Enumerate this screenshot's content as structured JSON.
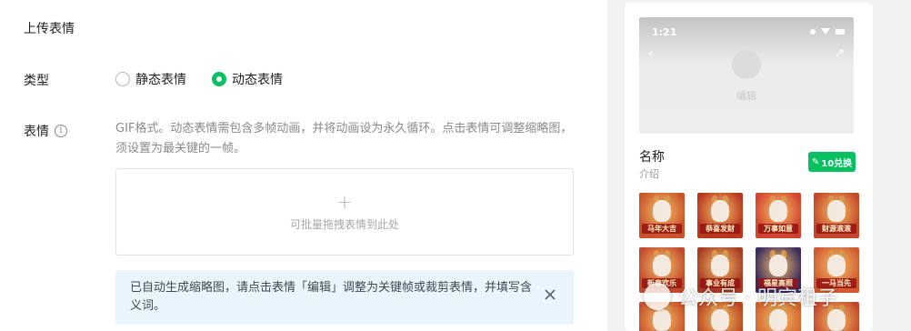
{
  "form": {
    "section_title": "上传表情",
    "type_label": "类型",
    "type_options": [
      {
        "label": "静态表情",
        "checked": false
      },
      {
        "label": "动态表情",
        "checked": true
      }
    ],
    "sticker_label": "表情",
    "info_icon": "info-icon",
    "hint": "GIF格式。动态表情需包含多帧动画，并将动画设为永久循环。点击表情可调整缩略图，须设置为最关键的一帧。",
    "dropzone_text": "可批量拖拽表情到此处",
    "notice": "已自动生成缩略图，请点击表情「编辑」调整为关键帧或裁剪表情，并填写含义词。",
    "accent_color": "#07c160"
  },
  "preview": {
    "status_time": "1:21",
    "editor_label": "编辑",
    "name": "名称",
    "intro": "介绍",
    "redeem_label": "10兑换",
    "stickers": [
      {
        "caption": "马年大吉",
        "bg": "#c9542a"
      },
      {
        "caption": "恭喜发财",
        "bg": "#b8361d"
      },
      {
        "caption": "万事如意",
        "bg": "#d2432d"
      },
      {
        "caption": "财源滚滚",
        "bg": "#c44727"
      },
      {
        "caption": "新春欢乐",
        "bg": "#c24a2c"
      },
      {
        "caption": "事业有成",
        "bg": "#a63a22"
      },
      {
        "caption": "福星高照",
        "bg": "#3a2a5e"
      },
      {
        "caption": "一马当先",
        "bg": "#cf5a2f"
      },
      {
        "caption": "",
        "bg": "#c8502a"
      },
      {
        "caption": "",
        "bg": "#b9451f"
      },
      {
        "caption": "",
        "bg": "#d0612c"
      },
      {
        "caption": "",
        "bg": "#c3462a"
      }
    ]
  },
  "watermark": "公众号 · 明宾租子"
}
